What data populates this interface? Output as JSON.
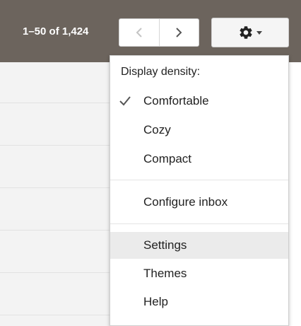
{
  "toolbar": {
    "pagination_text": "1–50 of 1,424",
    "prev_icon": "chevron-left-icon",
    "next_icon": "chevron-right-icon",
    "settings_icon": "gear-icon",
    "dropdown_icon": "caret-down-icon",
    "background_color": "#6c645d"
  },
  "menu": {
    "header": "Display density:",
    "density_options": [
      {
        "label": "Comfortable",
        "checked": true
      },
      {
        "label": "Cozy",
        "checked": false
      },
      {
        "label": "Compact",
        "checked": false
      }
    ],
    "configure_label": "Configure inbox",
    "settings_label": "Settings",
    "themes_label": "Themes",
    "help_label": "Help",
    "highlighted_item": "Settings"
  }
}
